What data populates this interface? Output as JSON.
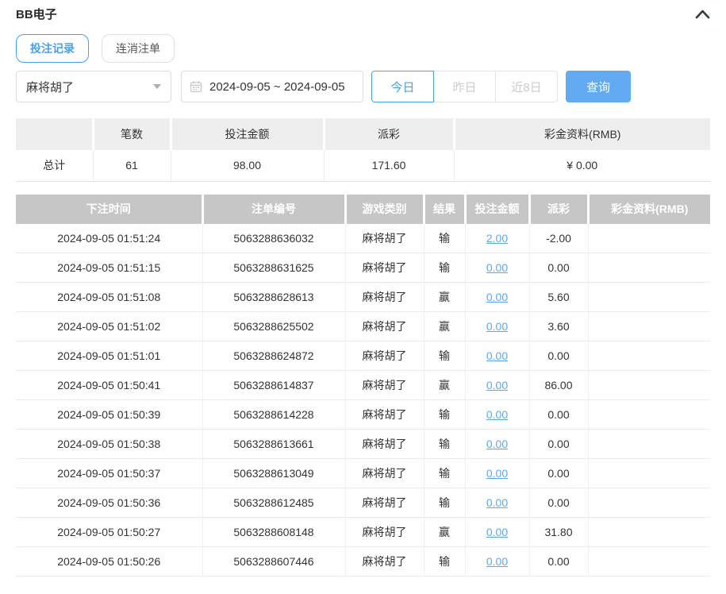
{
  "page": {
    "title": "BB电子"
  },
  "icons": {
    "collapse": "chevron-up",
    "date": "calendar",
    "select_caret": "chevron-down"
  },
  "tabs": [
    {
      "label": "投注记录",
      "active": true
    },
    {
      "label": "连消注单",
      "active": false
    }
  ],
  "filters": {
    "game_select": {
      "value": "麻将胡了"
    },
    "date_range": {
      "value": "2024-09-05 ~ 2024-09-05"
    },
    "quick_ranges": [
      {
        "label": "今日",
        "active": true
      },
      {
        "label": "昨日",
        "active": false
      },
      {
        "label": "近8日",
        "active": false
      }
    ],
    "search_label": "查询"
  },
  "summary": {
    "headers": [
      "",
      "笔数",
      "投注金额",
      "派彩",
      "彩金资料(RMB)"
    ],
    "total": {
      "label": "总计",
      "count": "61",
      "bet_amount": "98.00",
      "payout": "171.60",
      "bonus": "¥ 0.00"
    }
  },
  "records": {
    "headers": [
      "下注时间",
      "注单编号",
      "游戏类别",
      "结果",
      "投注金额",
      "派彩",
      "彩金资料(RMB)"
    ],
    "rows": [
      {
        "time": "2024-09-05 01:51:24",
        "order_id": "5063288636032",
        "game": "麻将胡了",
        "result": "输",
        "bet": "2.00",
        "payout": "-2.00",
        "bonus": ""
      },
      {
        "time": "2024-09-05 01:51:15",
        "order_id": "5063288631625",
        "game": "麻将胡了",
        "result": "输",
        "bet": "0.00",
        "payout": "0.00",
        "bonus": ""
      },
      {
        "time": "2024-09-05 01:51:08",
        "order_id": "5063288628613",
        "game": "麻将胡了",
        "result": "赢",
        "bet": "0.00",
        "payout": "5.60",
        "bonus": ""
      },
      {
        "time": "2024-09-05 01:51:02",
        "order_id": "5063288625502",
        "game": "麻将胡了",
        "result": "赢",
        "bet": "0.00",
        "payout": "3.60",
        "bonus": ""
      },
      {
        "time": "2024-09-05 01:51:01",
        "order_id": "5063288624872",
        "game": "麻将胡了",
        "result": "输",
        "bet": "0.00",
        "payout": "0.00",
        "bonus": ""
      },
      {
        "time": "2024-09-05 01:50:41",
        "order_id": "5063288614837",
        "game": "麻将胡了",
        "result": "赢",
        "bet": "0.00",
        "payout": "86.00",
        "bonus": ""
      },
      {
        "time": "2024-09-05 01:50:39",
        "order_id": "5063288614228",
        "game": "麻将胡了",
        "result": "输",
        "bet": "0.00",
        "payout": "0.00",
        "bonus": ""
      },
      {
        "time": "2024-09-05 01:50:38",
        "order_id": "5063288613661",
        "game": "麻将胡了",
        "result": "输",
        "bet": "0.00",
        "payout": "0.00",
        "bonus": ""
      },
      {
        "time": "2024-09-05 01:50:37",
        "order_id": "5063288613049",
        "game": "麻将胡了",
        "result": "输",
        "bet": "0.00",
        "payout": "0.00",
        "bonus": ""
      },
      {
        "time": "2024-09-05 01:50:36",
        "order_id": "5063288612485",
        "game": "麻将胡了",
        "result": "输",
        "bet": "0.00",
        "payout": "0.00",
        "bonus": ""
      },
      {
        "time": "2024-09-05 01:50:27",
        "order_id": "5063288608148",
        "game": "麻将胡了",
        "result": "赢",
        "bet": "0.00",
        "payout": "31.80",
        "bonus": ""
      },
      {
        "time": "2024-09-05 01:50:26",
        "order_id": "5063288607446",
        "game": "麻将胡了",
        "result": "输",
        "bet": "0.00",
        "payout": "0.00",
        "bonus": ""
      }
    ]
  },
  "colors": {
    "accent_blue": "#4aa0e8",
    "search_button_blue": "#62abf2",
    "bet_link_blue": "#5aa9f0",
    "negative_red": "#f0545c",
    "records_header_gray": "#c6c6c6",
    "summary_header_gray": "#eeeeee"
  }
}
